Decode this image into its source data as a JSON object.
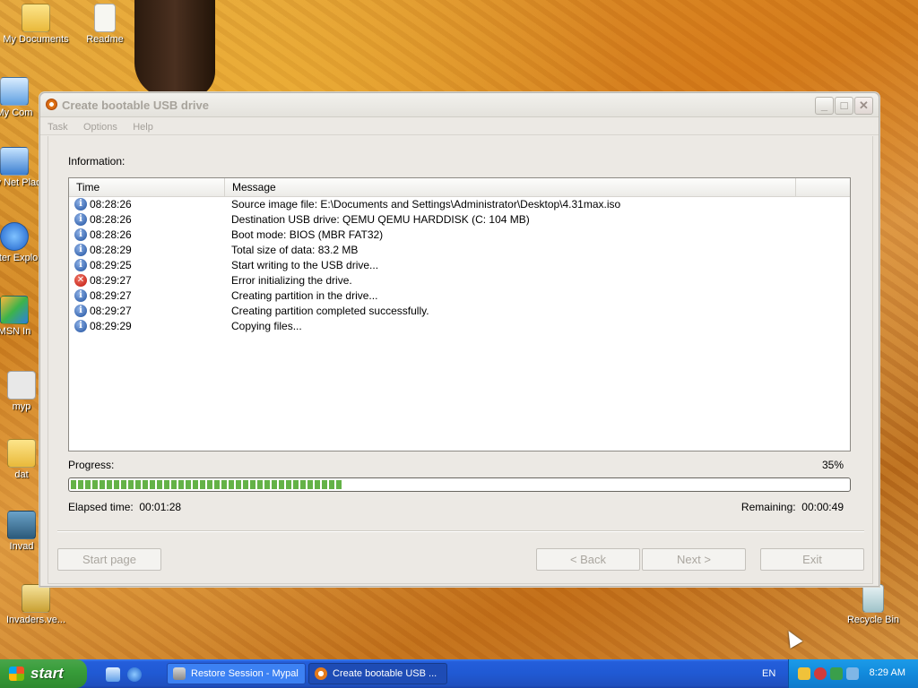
{
  "desktop": {
    "icons": [
      {
        "label": "My Documents"
      },
      {
        "label": "Readme"
      },
      {
        "label": "My Com"
      },
      {
        "label": "My Net Plac"
      },
      {
        "label": "Inter Explo"
      },
      {
        "label": "MSN In"
      },
      {
        "label": "myp"
      },
      {
        "label": "dat"
      },
      {
        "label": "Invad"
      },
      {
        "label": "Invaders.ve..."
      },
      {
        "label": "Recycle Bin"
      }
    ]
  },
  "window": {
    "title": "Create bootable USB drive",
    "menu": [
      "Task",
      "Options",
      "Help"
    ],
    "controls": {
      "minimize": "_",
      "maximize": "□",
      "close": "✕"
    },
    "info_label": "Information:",
    "log": {
      "columns": [
        "Time",
        "Message"
      ],
      "rows": [
        {
          "type": "info",
          "time": "08:28:26",
          "message": "Source image file: E:\\Documents and Settings\\Administrator\\Desktop\\4.31max.iso"
        },
        {
          "type": "info",
          "time": "08:28:26",
          "message": "Destination USB drive: QEMU QEMU HARDDISK (C:  104 MB)"
        },
        {
          "type": "info",
          "time": "08:28:26",
          "message": "Boot mode: BIOS (MBR FAT32)"
        },
        {
          "type": "info",
          "time": "08:28:29",
          "message": "Total size of data: 83.2 MB"
        },
        {
          "type": "info",
          "time": "08:29:25",
          "message": "Start writing to the USB drive..."
        },
        {
          "type": "error",
          "time": "08:29:27",
          "message": "Error initializing the drive."
        },
        {
          "type": "info",
          "time": "08:29:27",
          "message": "Creating partition in the drive..."
        },
        {
          "type": "info",
          "time": "08:29:27",
          "message": "Creating partition completed successfully."
        },
        {
          "type": "info",
          "time": "08:29:29",
          "message": "Copying files..."
        }
      ]
    },
    "progress": {
      "label": "Progress:",
      "percent_text": "35%",
      "value": 0.35
    },
    "elapsed": {
      "label": "Elapsed time:",
      "value": "00:01:28"
    },
    "remaining": {
      "label": "Remaining:",
      "value": "00:00:49"
    },
    "buttons": {
      "start_page": "Start page",
      "back": "< Back",
      "next": "Next >",
      "exit": "Exit"
    }
  },
  "taskbar": {
    "start_label": "start",
    "tasks": [
      {
        "label": "Restore Session - Mypal",
        "active": false
      },
      {
        "label": "Create bootable USB ...",
        "active": true
      }
    ],
    "language": "EN",
    "clock": "8:29 AM"
  },
  "colors": {
    "progress_fill": "#64b247",
    "error_icon": "#c0120a",
    "info_icon": "#1d4f9d"
  }
}
